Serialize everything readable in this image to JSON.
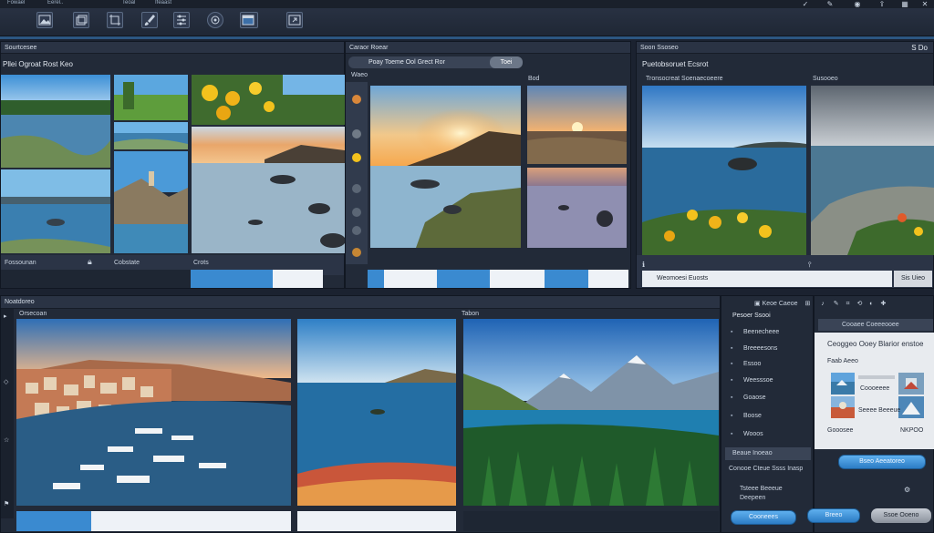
{
  "menu": {
    "items": [
      "Fowael",
      "Eerel..",
      "Teoal",
      "Ifeaast"
    ]
  },
  "toolbar": {
    "buttons": [
      "image-icon",
      "layers-icon",
      "crop-icon",
      "brush-icon",
      "adjust-icon",
      "gallery-icon",
      "window-icon",
      "export-icon"
    ]
  },
  "left_panel": {
    "header": "Sourtcesee",
    "subtitle": "Pllei Ogroat Rost Keo",
    "footer_label": "Fossounan",
    "footer_label2": "Cobstate",
    "footer_label3": "Crots"
  },
  "center_panel": {
    "header": "Caraor Roear",
    "title": "Poay Toeme Ool Grect Ror",
    "tab": "Toei",
    "sub_label": "Waeo",
    "side_label": "Bod"
  },
  "right_panel": {
    "header": "Soon Ssoseo",
    "header_right": "S Do",
    "subtitle": "Puetobsoruet Ecsrot",
    "caption": "Tronsocreat Soenaecoeere",
    "side_label": "Susooeo",
    "footer_label": "Weomoesi Euosts",
    "footer_btn": "Sis Uieo"
  },
  "bottom_panel": {
    "header": "Noatdoreo",
    "sub_left": "Orsecoan",
    "sub_center": "Tabon"
  },
  "list_panel": {
    "header": "Pesoer Ssooi",
    "items": [
      "Beenecheee",
      "Breeeesons",
      "Essoo",
      "Weesssoe",
      "Goaose",
      "Boose",
      "Wooos"
    ],
    "footer": "Beaue Inoeao",
    "footer2": "Conooe Cteue Ssss Inasp",
    "bottom_rows": [
      "Tsteee Beeeue",
      "Deepeen"
    ],
    "btn_left": "Cooneees",
    "btn_mid": "Breeo",
    "btn_right": "Ssoe Ooeno"
  },
  "inspector": {
    "header": "Keoe Caeoe",
    "tab": "Cooaee Coeeeooee",
    "title": "Ceoggeo Ooey Blarior enstoe",
    "label_a": "Faab Aeeo",
    "row1": "Coooeeee",
    "row2": "Seeee Beeeue",
    "foot_left": "Gooosee",
    "foot_right": "NKPOO",
    "action": "Bseo Aeeatoreo"
  }
}
